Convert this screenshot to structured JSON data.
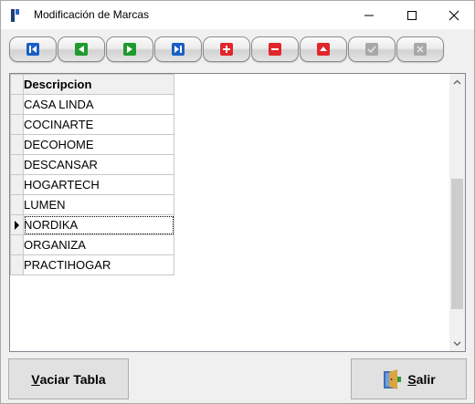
{
  "window": {
    "title": "Modificación de Marcas"
  },
  "toolbar": {
    "buttons": [
      {
        "name": "first",
        "icon": "first-record-icon",
        "color": "#1a5fc4"
      },
      {
        "name": "previous",
        "icon": "previous-record-icon",
        "color": "#1e9a2e"
      },
      {
        "name": "next",
        "icon": "next-record-icon",
        "color": "#1e9a2e"
      },
      {
        "name": "last",
        "icon": "last-record-icon",
        "color": "#1a5fc4"
      },
      {
        "name": "insert",
        "icon": "plus-icon",
        "color": "#e0262b"
      },
      {
        "name": "delete",
        "icon": "minus-icon",
        "color": "#e0262b"
      },
      {
        "name": "edit",
        "icon": "triangle-up-icon",
        "color": "#e0262b"
      },
      {
        "name": "post",
        "icon": "check-icon",
        "color": "#a8a8a8"
      },
      {
        "name": "cancel",
        "icon": "x-icon",
        "color": "#a8a8a8"
      }
    ]
  },
  "grid": {
    "column_header": "Descripcion",
    "rows": [
      "CASA LINDA",
      "COCINARTE",
      "DECOHOME",
      "DESCANSAR",
      "HOGARTECH",
      "LUMEN",
      "NORDIKA",
      "ORGANIZA",
      "PRACTIHOGAR"
    ],
    "current_row": "NORDIKA"
  },
  "buttons": {
    "vaciar_first": "V",
    "vaciar_rest": "aciar Tabla",
    "salir_first": "S",
    "salir_rest": "alir"
  }
}
